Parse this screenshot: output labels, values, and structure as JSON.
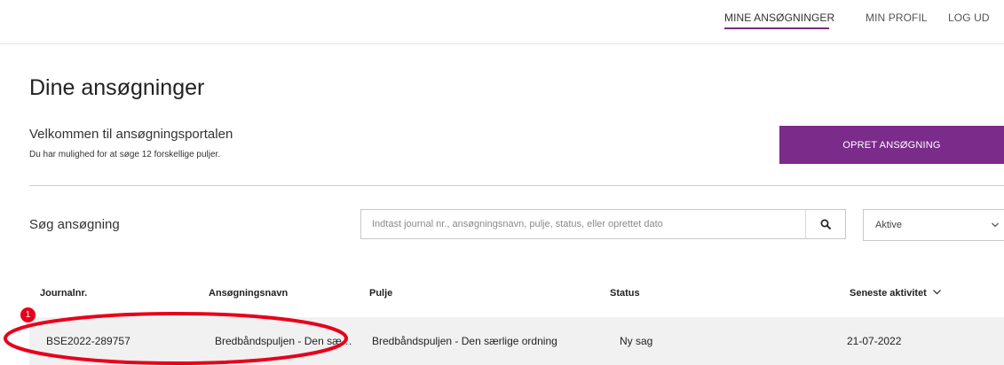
{
  "nav": {
    "items": [
      {
        "label": "MINE ANSØGNINGER",
        "active": true
      },
      {
        "label": "MIN PROFIL",
        "active": false
      },
      {
        "label": "LOG UD",
        "active": false
      }
    ]
  },
  "page": {
    "title": "Dine ansøgninger",
    "welcome": "Velkommen til ansøgningsportalen",
    "subtext": "Du har mulighed for at søge 12 forskellige puljer.",
    "create_button": "OPRET ANSØGNING"
  },
  "search": {
    "label": "Søg ansøgning",
    "placeholder": "Indtast journal nr., ansøgningsnavn, pulje, status, eller oprettet dato",
    "icon": "search-icon"
  },
  "filter": {
    "selected": "Aktive"
  },
  "table": {
    "headers": {
      "journal": "Journalnr.",
      "name": "Ansøgningsnavn",
      "pool": "Pulje",
      "status": "Status",
      "activity": "Seneste aktivitet"
    },
    "rows": [
      {
        "journal": "BSE2022-289757",
        "name": "Bredbåndspuljen - Den sæ…",
        "pool": "Bredbåndspuljen - Den særlige ordning",
        "status": "Ny sag",
        "activity": "21-07-2022"
      }
    ]
  },
  "annotation": {
    "badge": "1",
    "color": "#e8001c"
  },
  "colors": {
    "accent": "#7b2b8a"
  }
}
